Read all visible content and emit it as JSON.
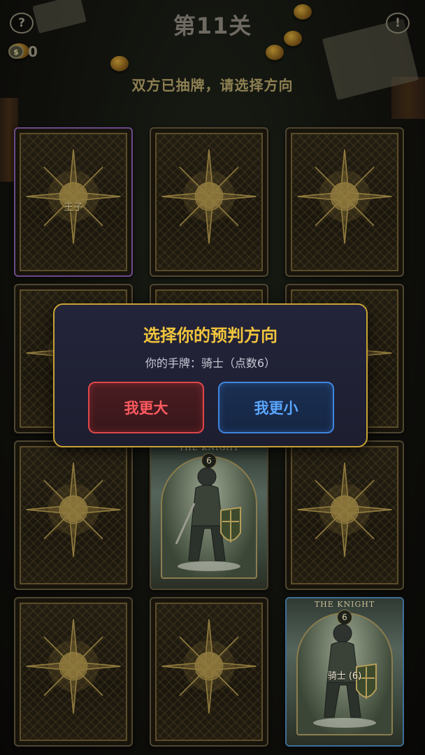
{
  "header": {
    "help_icon_glyph": "?",
    "level_title": "第11关",
    "info_icon_glyph": "!",
    "coin_symbol": "$",
    "coin_count": "0",
    "status_text": "双方已抽牌，请选择方向"
  },
  "cards": [
    {
      "state": "back",
      "label": "王子",
      "highlight": "purple"
    },
    {
      "state": "back",
      "label": ""
    },
    {
      "state": "back",
      "label": ""
    },
    {
      "state": "back",
      "label": ""
    },
    {
      "state": "back",
      "label": ""
    },
    {
      "state": "back",
      "label": ""
    },
    {
      "state": "back",
      "label": ""
    },
    {
      "state": "face",
      "title": "THE KNIGHT",
      "number": "6",
      "caption": ""
    },
    {
      "state": "back",
      "label": ""
    },
    {
      "state": "back",
      "label": ""
    },
    {
      "state": "back",
      "label": ""
    },
    {
      "state": "face",
      "title": "THE KNIGHT",
      "number": "6",
      "caption": "骑士 (6)",
      "highlight": "blue"
    }
  ],
  "modal": {
    "title": "选择你的预判方向",
    "subtitle": "你的手牌：骑士（点数6）",
    "bigger_label": "我更大",
    "smaller_label": "我更小"
  },
  "colors": {
    "accent_gold": "#f2c53d",
    "bigger_red": "#ff5a5f",
    "smaller_blue": "#5aa6ff"
  }
}
